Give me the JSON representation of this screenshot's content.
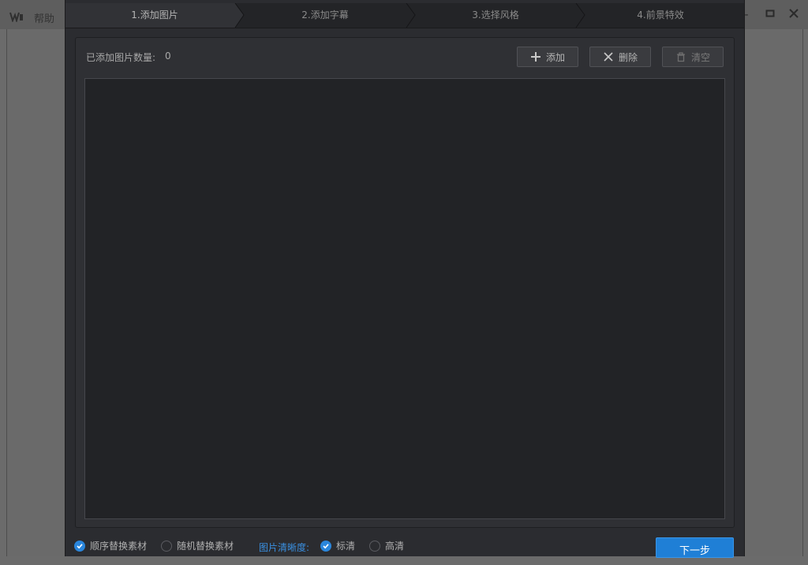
{
  "app": {
    "help_label": "帮助",
    "window_controls": {
      "minimize": "-",
      "maximize": "□",
      "close": "✕"
    }
  },
  "steps": [
    {
      "label": "1.添加图片",
      "active": true
    },
    {
      "label": "2.添加字幕",
      "active": false
    },
    {
      "label": "3.选择风格",
      "active": false
    },
    {
      "label": "4.前景特效",
      "active": false
    }
  ],
  "panel": {
    "count_label": "已添加图片数量:",
    "count_value": "0",
    "buttons": {
      "add": "添加",
      "delete": "删除",
      "clear": "清空"
    }
  },
  "footer": {
    "sequential_replace": "顺序替换素材",
    "random_replace": "随机替换素材",
    "clarity_label": "图片清晰度:",
    "standard": "标清",
    "high": "高清",
    "next_button": "下一步"
  },
  "colors": {
    "accent": "#2a86dc",
    "dialog_bg": "#2b2c30"
  }
}
